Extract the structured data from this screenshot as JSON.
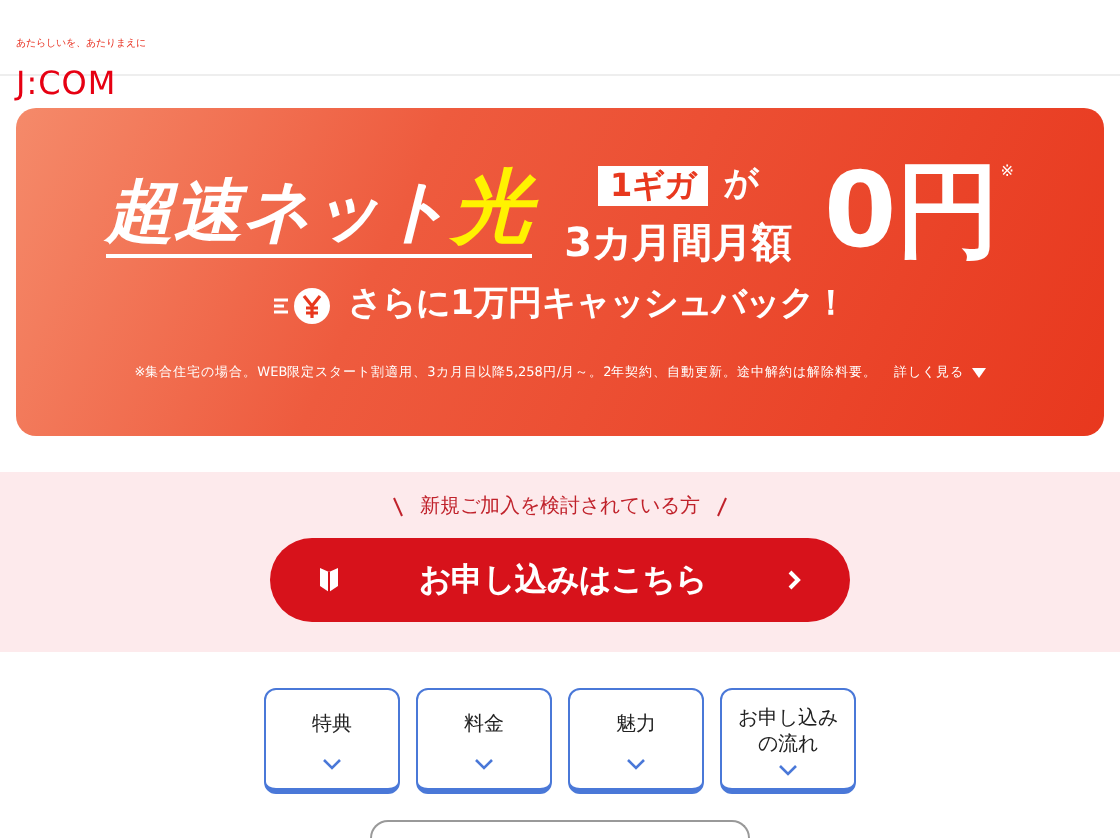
{
  "header": {
    "tagline": "あたらしいを、あたりまえに",
    "logo": "J:COM"
  },
  "banner": {
    "headline": [
      {
        "text": "超速ネット",
        "highlight": false
      },
      {
        "text": "光",
        "highlight": true
      }
    ],
    "speed_tag": "1ギガ",
    "particle": "が",
    "period": "3カ月間月額",
    "price": "0円",
    "price_mark": "※",
    "cashback": "さらに1万円キャッシュバック！",
    "footnote": "※集合住宅の場合。WEB限定スタート割適用、3カ月目以降5,258円/月～。2年契約、自動更新。途中解約は解除料要。",
    "more_link": "詳しく見る"
  },
  "signup": {
    "lead": "新規ご加入を検討されている方",
    "button": "お申し込みはこちら"
  },
  "nav_buttons": [
    {
      "label": "特典"
    },
    {
      "label": "料金"
    },
    {
      "label": "魅力"
    },
    {
      "label": "お申し込みの流れ"
    }
  ]
}
